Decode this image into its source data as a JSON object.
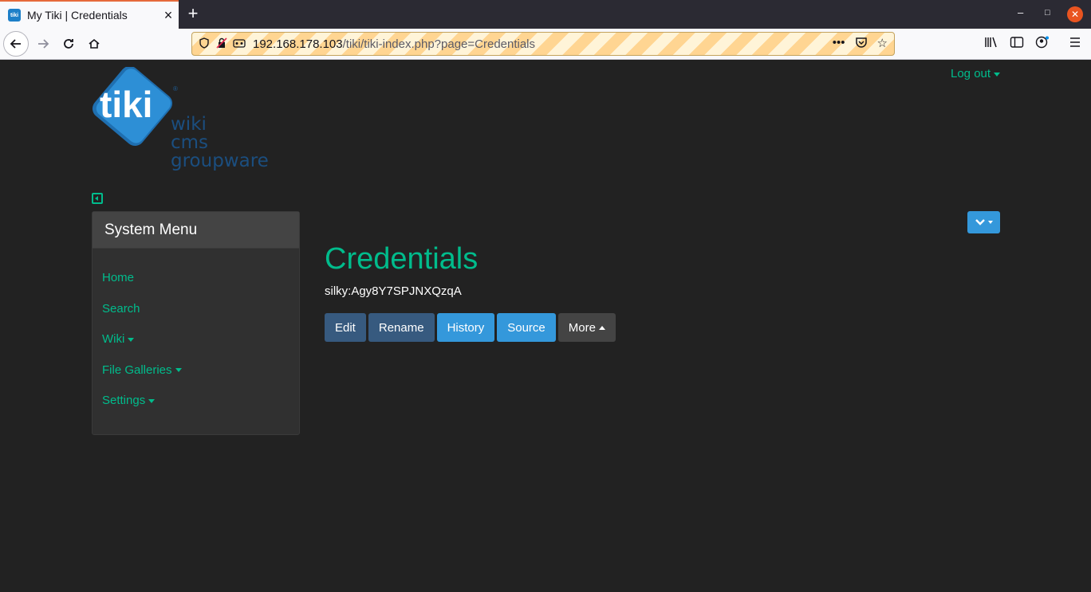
{
  "browser": {
    "tab_title": "My Tiki | Credentials",
    "tab_favicon_text": "tiki",
    "url_host": "192.168.178.103",
    "url_path": "/tiki/tiki-index.php?page=Credentials"
  },
  "header": {
    "logo": {
      "wordmark": "tiki",
      "tagline_1": "wiki",
      "tagline_2": "cms",
      "tagline_3": "groupware"
    },
    "logout_label": "Log out"
  },
  "sidebar": {
    "title": "System Menu",
    "items": [
      {
        "label": "Home",
        "has_caret": false
      },
      {
        "label": "Search",
        "has_caret": false
      },
      {
        "label": "Wiki",
        "has_caret": true
      },
      {
        "label": "File Galleries",
        "has_caret": true
      },
      {
        "label": "Settings",
        "has_caret": true
      }
    ]
  },
  "page": {
    "title": "Credentials",
    "content": "silky:Agy8Y7SPJNXQzqA",
    "buttons": {
      "edit": "Edit",
      "rename": "Rename",
      "history": "History",
      "source": "Source",
      "more": "More"
    }
  },
  "colors": {
    "accent": "#00bc8c",
    "background": "#222222",
    "panel": "#303030",
    "btn_primary": "#375a7f",
    "btn_info": "#3498db"
  }
}
